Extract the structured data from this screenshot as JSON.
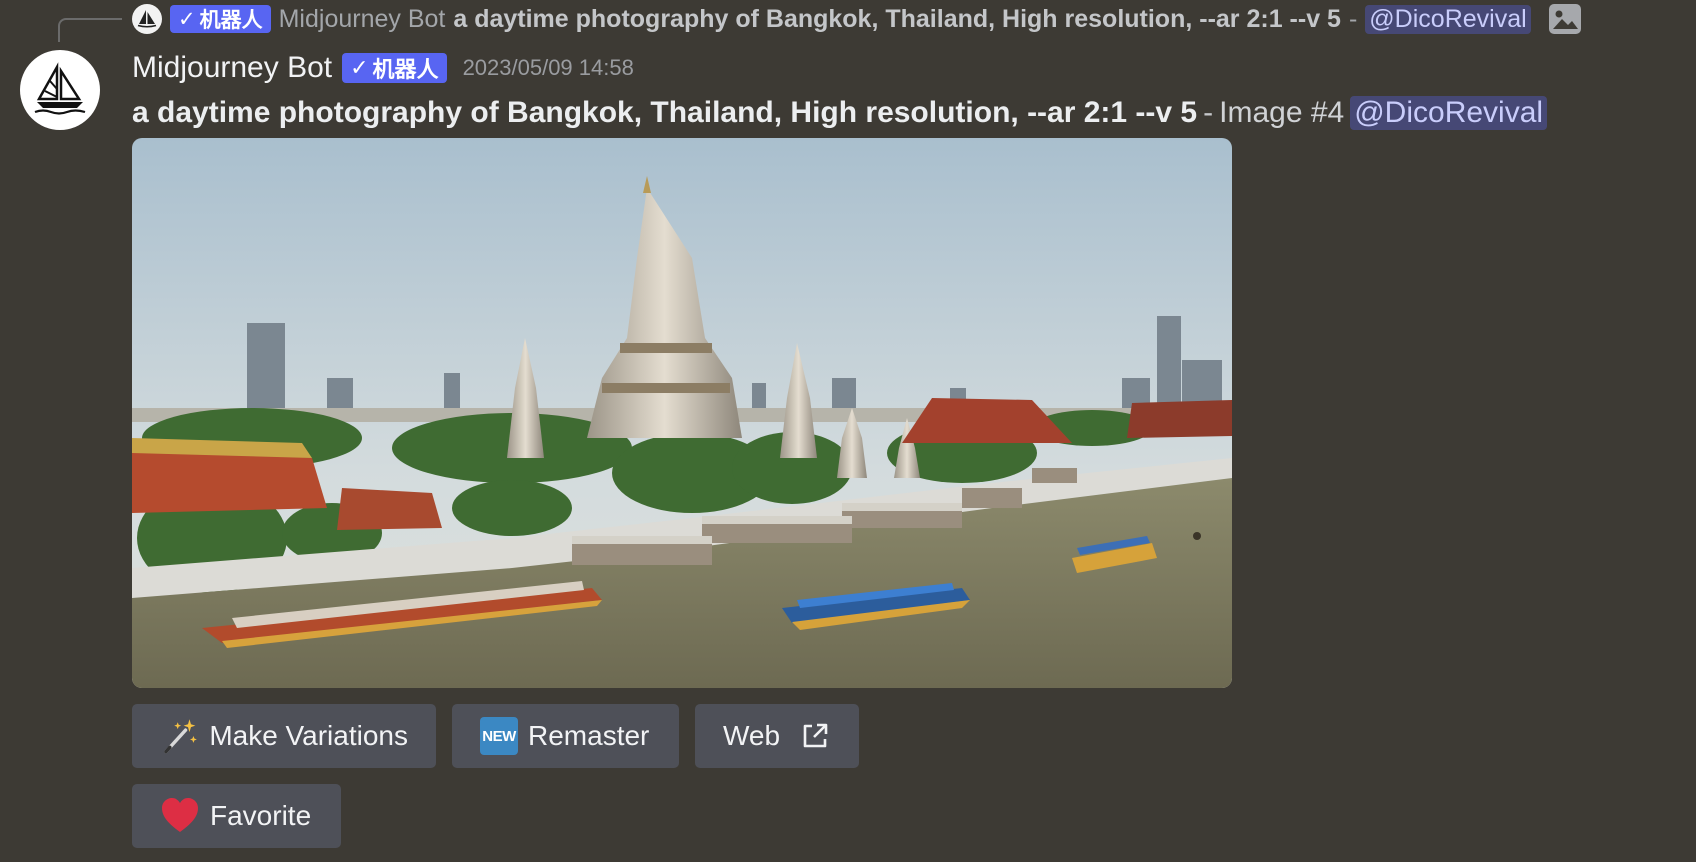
{
  "reply": {
    "bot_tag": "机器人",
    "username": "Midjourney Bot",
    "prompt": "a daytime photography of Bangkok, Thailand, High resolution, --ar 2:1 --v 5",
    "separator": "-",
    "mention": "@DicoRevival"
  },
  "message": {
    "username": "Midjourney Bot",
    "bot_tag": "机器人",
    "timestamp": "2023/05/09 14:58",
    "prompt": "a daytime photography of Bangkok, Thailand, High resolution, --ar 2:1 --v 5",
    "separator": "-",
    "image_label": "Image #4",
    "mention": "@DicoRevival"
  },
  "buttons": {
    "make_variations": "Make Variations",
    "remaster": "Remaster",
    "remaster_badge": "NEW",
    "web": "Web",
    "favorite": "Favorite"
  },
  "icons": {
    "wand": "magic-wand-icon",
    "new": "new-badge-icon",
    "external": "external-link-icon",
    "heart": "heart-icon",
    "image": "image-icon",
    "verified": "checkmark-icon"
  },
  "colors": {
    "background": "#3d3a34",
    "bot_tag": "#5865f2",
    "button": "#4e5058",
    "mention_bg": "rgba(88,101,242,0.35)"
  }
}
